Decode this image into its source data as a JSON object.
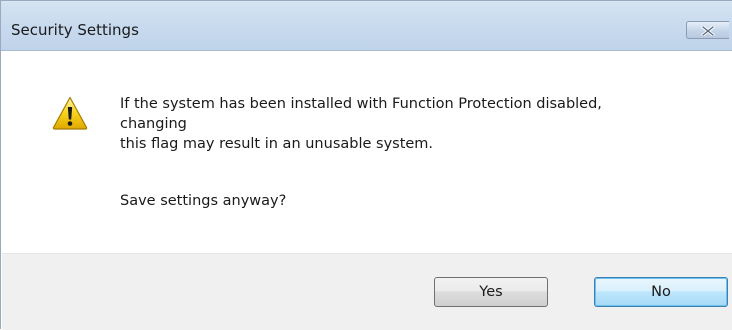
{
  "window": {
    "title": "Security Settings"
  },
  "message": {
    "line1": "If the system has been installed with Function Protection disabled,",
    "line2": "changing",
    "line3": "this flag may result in an unusable system.",
    "question": "Save settings anyway?"
  },
  "buttons": {
    "yes_label": "Yes",
    "no_label": "No",
    "default": "No"
  },
  "icons": {
    "warning": "warning-icon",
    "close": "close-icon"
  },
  "colors": {
    "titlebar": "#c9dbef",
    "footer": "#f0f0f0",
    "warning_yellow": "#f7d21c",
    "default_button_border": "#3c7fb1"
  }
}
